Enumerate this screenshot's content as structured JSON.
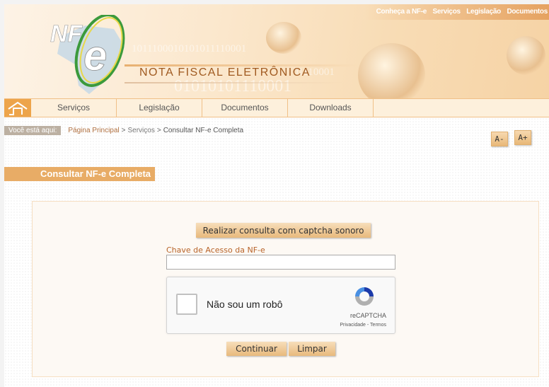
{
  "header": {
    "top_links": [
      "Conheça a NF-e",
      "Serviços",
      "Legislação",
      "Documentos"
    ],
    "logo_text": "NF-e",
    "brand": "NOTA FISCAL ELETRÔNICA",
    "binary_1": "1011100010101011110001",
    "binary_2": "01110001",
    "binary_3": "01010101110001"
  },
  "nav": {
    "items": [
      "Serviços",
      "Legislação",
      "Documentos",
      "Downloads"
    ]
  },
  "breadcrumb": {
    "label": "Você está aqui:",
    "items": [
      "Página Principal",
      "Serviços",
      "Consultar NF-e Completa"
    ],
    "separator": ">"
  },
  "font_controls": {
    "decrease": "A-",
    "increase": "A+"
  },
  "page_title": "Consultar NF-e Completa",
  "form": {
    "audio_captcha_button": "Realizar consulta com captcha sonoro",
    "key_label": "Chave de Acesso da NF-e",
    "key_value": "",
    "recaptcha": {
      "text": "Não sou um robô",
      "brand": "reCAPTCHA",
      "privacy": "Privacidade",
      "terms": "Termos",
      "checked": false
    },
    "continue_button": "Continuar",
    "clear_button": "Limpar"
  },
  "colors": {
    "accent": "#e8ac66",
    "nav_bg": "#fdf0dc",
    "label": "#b8642a"
  }
}
